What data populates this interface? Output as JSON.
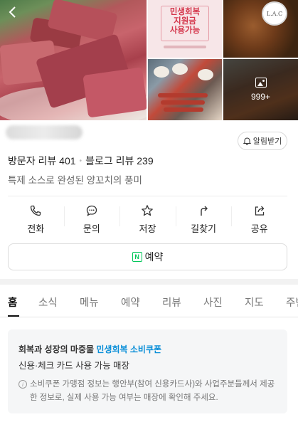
{
  "header": {
    "photo_more_count": "999+",
    "poster_lines": [
      "민생회복",
      "지원금",
      "사용가능"
    ],
    "logo_text": "L.A.C"
  },
  "place": {
    "notify_label": "알림받기",
    "visitor_reviews": "방문자 리뷰 401",
    "blog_reviews": "블로그 리뷰 239",
    "description": "특제 소스로 완성된 양꼬치의 풍미"
  },
  "actions": [
    {
      "label": "전화",
      "icon": "phone-icon"
    },
    {
      "label": "문의",
      "icon": "chat-icon"
    },
    {
      "label": "저장",
      "icon": "star-icon"
    },
    {
      "label": "길찾기",
      "icon": "directions-icon"
    },
    {
      "label": "공유",
      "icon": "share-icon"
    }
  ],
  "reserve": {
    "label": "예약",
    "icon_letter": "N",
    "accent": "#03c75a"
  },
  "tabs": [
    "홈",
    "소식",
    "메뉴",
    "예약",
    "리뷰",
    "사진",
    "지도",
    "주변"
  ],
  "coupon": {
    "prefix": "회복과 성장의 마중물 ",
    "highlight": "민생회복 소비쿠폰",
    "highlight_color": "#0a8fd8",
    "line2": "신용·체크 카드 사용 가능 매장",
    "note": "소비쿠폰 가맹점 정보는 행안부(참여 신용카드사)와 사업주분들께서 제공한 정보로, 실제 사용 가능 여부는 매장에 확인해 주세요."
  }
}
